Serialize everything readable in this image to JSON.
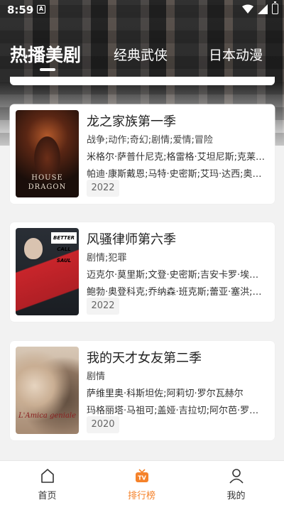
{
  "status_bar": {
    "time": "8:59",
    "notification_glyph": "A"
  },
  "tabs": [
    {
      "label": "热播美剧",
      "active": true
    },
    {
      "label": "经典武侠",
      "active": false
    },
    {
      "label": "日本动漫",
      "active": false
    }
  ],
  "shows": [
    {
      "title": "龙之家族第一季",
      "genres": "战争;动作;奇幻;剧情;爱情;冒险",
      "cast_line1": "米格尔·萨普什尼克;格雷格·艾坦尼斯;克莱尔·基尔纳",
      "cast_line2": "帕迪·康斯戴恩;马特·史密斯;艾玛·达西;奥利维亚·库克",
      "year": "2022",
      "poster_text": [
        "HOUSE",
        "DRAGON"
      ]
    },
    {
      "title": "风骚律师第六季",
      "genres": "剧情;犯罪",
      "cast_line1": "迈克尔·莫里斯;文登·史密斯;吉安卡罗·埃斯波西托",
      "cast_line2": "鲍勃·奥登科克;乔纳森·班克斯;蕾亚·塞洪;迈克尔·曼多",
      "year": "2022",
      "poster_text": [
        "BETTER CALL SAUL"
      ]
    },
    {
      "title": "我的天才女友第二季",
      "genres": "剧情",
      "cast_line1": "萨维里奥·科斯坦佐;阿莉切·罗尔瓦赫尔",
      "cast_line2": "玛格丽塔·马祖可;盖娅·吉拉切;阿尔芭·罗尔瓦赫尔",
      "year": "2020",
      "poster_text": [
        "L'Amica geniale"
      ]
    }
  ],
  "bottom_nav": [
    {
      "label": "首页",
      "icon": "home-icon",
      "active": false
    },
    {
      "label": "排行榜",
      "icon": "tv-ranking-icon",
      "active": true
    },
    {
      "label": "我的",
      "icon": "user-icon",
      "active": false
    }
  ],
  "colors": {
    "accent": "#f5822a",
    "background": "#f2f2f2"
  }
}
